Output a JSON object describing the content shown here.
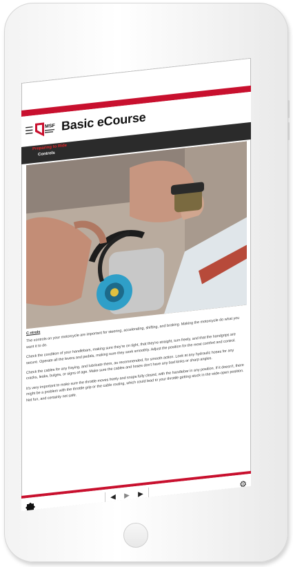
{
  "header": {
    "menu_icon": "hamburger-menu-icon",
    "logo_text": "MSF",
    "title": "Basic eCourse"
  },
  "breadcrumb": {
    "section": "Preparing to Ride",
    "page": "Controls"
  },
  "content": {
    "heading": "C ntrols",
    "paragraphs": [
      "The controls on your motorcycle are important for steering, accelerating, shifting, and braking. Making the motorcycle do what you want it to do.",
      "Check the condition of your handlebars, making sure they're on tight, that they're straight, turn freely, and that the handgrips are secure. Operate all the levers and pedals, making sure they work smoothly. Adjust the position for the most comfort and control.",
      "Check the cables for any fraying, and lubricate them, as recommended, for smooth action. Look at any hydraulic hoses for any cracks, leaks, bulges, or signs of age. Make sure the cables and hoses don't have any bad kinks or sharp angles.",
      "It's very important to make sure the throttle moves freely and snaps fully closed, with the handlebar in any position. If it doesn't, there might be a problem with the throttle grip or the cable routing, which could lead to your throttle getting stuck in the wide-open position. Not fun, and certainly not safe."
    ]
  },
  "footer": {
    "badge_icon": "msf-seal-icon",
    "prev_icon": "◀",
    "play_icon": "▶",
    "next_icon": "▶",
    "settings_icon": "⚙"
  },
  "colors": {
    "brand_red": "#c8102e",
    "breadcrumb_bg": "#2b2b2b"
  }
}
